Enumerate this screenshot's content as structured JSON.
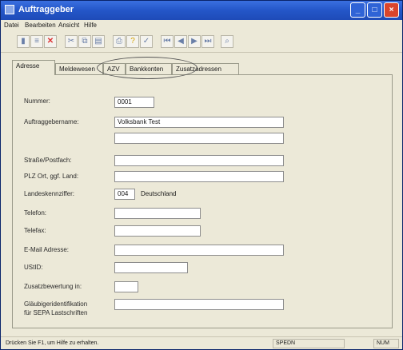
{
  "window": {
    "title": "Auftraggeber"
  },
  "menubar": {
    "items": [
      "Datei",
      "Bearbeiten",
      "Ansicht",
      "Hilfe"
    ]
  },
  "toolbar": {
    "icons": [
      "first-icon",
      "list-icon",
      "delete-icon",
      "cut-icon",
      "copy-icon",
      "paste-icon",
      "print-icon",
      "help-icon",
      "info-icon",
      "nav-first-icon",
      "nav-prev-icon",
      "nav-next-icon",
      "nav-last-icon",
      "search-icon"
    ]
  },
  "tabs": [
    "Adresse",
    "Meldewesen",
    "AZV",
    "Bankkonten",
    "Zusatzadressen"
  ],
  "form": {
    "nummer_label": "Nummer:",
    "nummer_value": "0001",
    "name_label": "Auftraggebername:",
    "name_value": "Volksbank Test",
    "strasse_label": "Straße/Postfach:",
    "plz_label": "PLZ Ort, ggf. Land:",
    "land_label": "Landeskennziffer:",
    "land_code": "004",
    "land_name": "Deutschland",
    "telefon_label": "Telefon:",
    "telefax_label": "Telefax:",
    "email_label": "E-Mail Adresse:",
    "ustid_label": "UStID:",
    "zusatz_label": "Zusatzbewertung in:",
    "glaeubiger_label_1": "Gläubigeridentifikation",
    "glaeubiger_label_2": "für SEPA Lastschriften"
  },
  "statusbar": {
    "message": "Drücken Sie F1, um Hilfe zu erhalten.",
    "cell_1": "SPEDN",
    "cell_2": "NUM"
  }
}
